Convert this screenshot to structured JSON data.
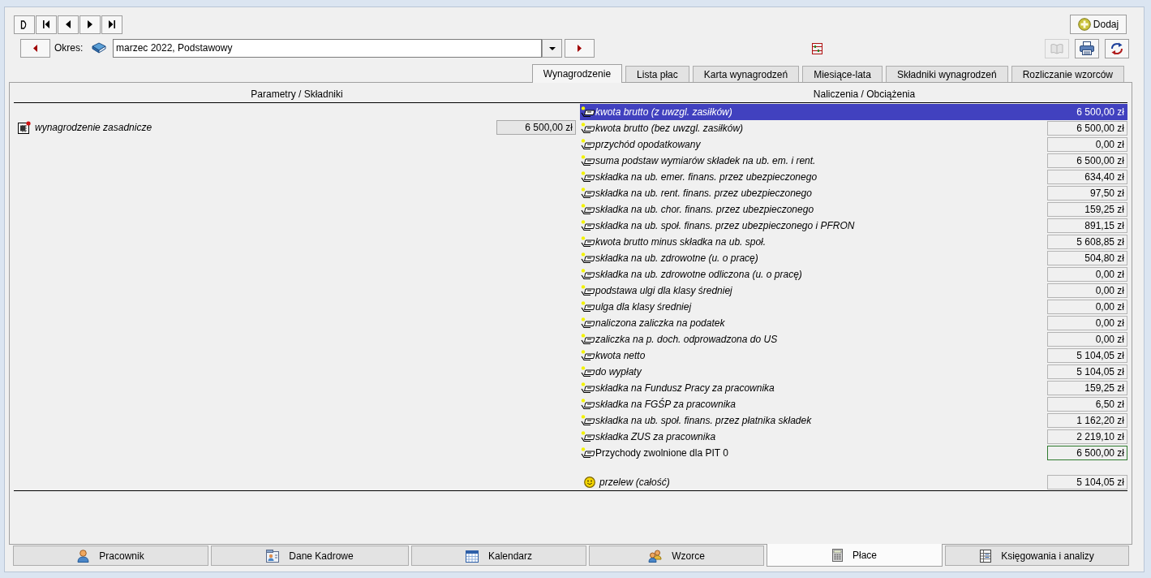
{
  "period": {
    "label": "Okres:",
    "value": "marzec 2022, Podstawowy"
  },
  "add_button": {
    "label": "Dodaj"
  },
  "toolbar_buttons": [
    {
      "disabled": true
    },
    {
      "disabled": false
    },
    {
      "disabled": false
    }
  ],
  "tabs": [
    {
      "label": "Wynagrodzenie",
      "selected": true
    },
    {
      "label": "Lista płac",
      "selected": false
    },
    {
      "label": "Karta wynagrodzeń",
      "selected": false
    },
    {
      "label": "Miesiące-lata",
      "selected": false
    },
    {
      "label": "Składniki wynagrodzeń",
      "selected": false
    },
    {
      "label": "Rozliczanie wzorców",
      "selected": false
    }
  ],
  "left_panel": {
    "heading": "Parametry / Składniki",
    "rows": [
      {
        "label": "wynagrodzenie zasadnicze",
        "value": "6 500,00 zł"
      }
    ]
  },
  "right_panel": {
    "heading": "Naliczenia / Obciążenia",
    "rows": [
      {
        "label": "kwota brutto (z uwzgl. zasiłków)",
        "value": "6 500,00 zł",
        "selected": true,
        "kind": "standard"
      },
      {
        "label": "kwota brutto (bez uwzgl. zasiłków)",
        "value": "6 500,00 zł",
        "selected": false,
        "kind": "standard"
      },
      {
        "label": "przychód opodatkowany",
        "value": "0,00 zł",
        "selected": false,
        "kind": "standard"
      },
      {
        "label": "suma podstaw wymiarów składek na ub. em. i rent.",
        "value": "6 500,00 zł",
        "selected": false,
        "kind": "standard"
      },
      {
        "label": "składka na ub. emer. finans. przez ubezpieczonego",
        "value": "634,40 zł",
        "selected": false,
        "kind": "standard"
      },
      {
        "label": "składka na ub. rent. finans. przez ubezpieczonego",
        "value": "97,50 zł",
        "selected": false,
        "kind": "standard"
      },
      {
        "label": "składka na ub. chor. finans. przez ubezpieczonego",
        "value": "159,25 zł",
        "selected": false,
        "kind": "standard"
      },
      {
        "label": "składka na ub. społ. finans. przez ubezpieczonego i PFRON",
        "value": "891,15 zł",
        "selected": false,
        "kind": "standard"
      },
      {
        "label": "kwota brutto minus składka na ub. społ.",
        "value": "5 608,85 zł",
        "selected": false,
        "kind": "standard"
      },
      {
        "label": "składka na ub. zdrowotne (u. o pracę)",
        "value": "504,80 zł",
        "selected": false,
        "kind": "standard"
      },
      {
        "label": "składka na ub. zdrowotne odliczona (u. o pracę)",
        "value": "0,00 zł",
        "selected": false,
        "kind": "standard"
      },
      {
        "label": "podstawa ulgi dla klasy średniej",
        "value": "0,00 zł",
        "selected": false,
        "kind": "standard"
      },
      {
        "label": "ulga dla klasy średniej",
        "value": "0,00 zł",
        "selected": false,
        "kind": "standard"
      },
      {
        "label": "naliczona zaliczka na podatek",
        "value": "0,00 zł",
        "selected": false,
        "kind": "standard"
      },
      {
        "label": "zaliczka na p. doch. odprowadzona do US",
        "value": "0,00 zł",
        "selected": false,
        "kind": "standard"
      },
      {
        "label": "kwota netto",
        "value": "5 104,05 zł",
        "selected": false,
        "kind": "standard"
      },
      {
        "label": "do wypłaty",
        "value": "5 104,05 zł",
        "selected": false,
        "kind": "standard"
      },
      {
        "label": "składka na Fundusz Pracy za pracownika",
        "value": "159,25 zł",
        "selected": false,
        "kind": "standard"
      },
      {
        "label": "składka na FGŚP za pracownika",
        "value": "6,50 zł",
        "selected": false,
        "kind": "standard"
      },
      {
        "label": "składka na ub. społ. finans. przez płatnika składek",
        "value": "1 162,20 zł",
        "selected": false,
        "kind": "standard"
      },
      {
        "label": "składka ZUS za pracownika",
        "value": "2 219,10 zł",
        "selected": false,
        "kind": "standard"
      },
      {
        "label": "Przychody zwolnione dla PIT 0",
        "value": "6 500,00 zł",
        "selected": false,
        "kind": "custom"
      }
    ],
    "summary": {
      "label": "przelew (całość)",
      "value": "5 104,05 zł"
    }
  },
  "bottom_tabs": [
    {
      "label": "Pracownik",
      "selected": false
    },
    {
      "label": "Dane Kadrowe",
      "selected": false
    },
    {
      "label": "Kalendarz",
      "selected": false
    },
    {
      "label": "Wzorce",
      "selected": false
    },
    {
      "label": "Płace",
      "selected": true
    },
    {
      "label": "Księgowania i analizy",
      "selected": false
    }
  ]
}
